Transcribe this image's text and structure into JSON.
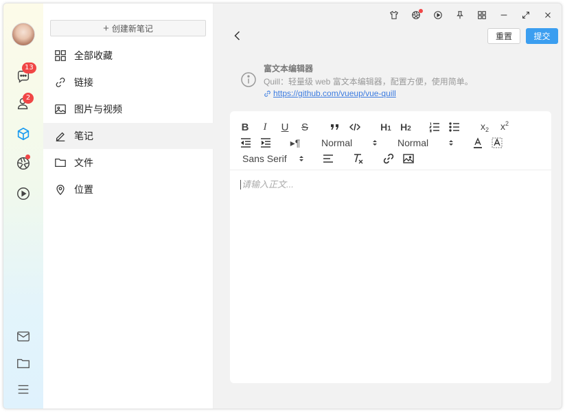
{
  "sidebar": {
    "new_note_label": "创建新笔记",
    "items": [
      {
        "label": "全部收藏",
        "icon": "grid-icon"
      },
      {
        "label": "链接",
        "icon": "link-icon"
      },
      {
        "label": "图片与视频",
        "icon": "image-icon"
      },
      {
        "label": "笔记",
        "icon": "pen-icon",
        "active": true
      },
      {
        "label": "文件",
        "icon": "folder-icon"
      },
      {
        "label": "位置",
        "icon": "location-icon"
      }
    ]
  },
  "rail": {
    "chat_badge": "13",
    "contacts_badge": "2",
    "accent_color": "#1a9bf0"
  },
  "header": {
    "reset_label": "重置",
    "submit_label": "提交"
  },
  "info": {
    "title": "富文本编辑器",
    "description": "Quill：轻量级 web 富文本编辑器，配置方便，使用简单。",
    "link": "https://github.com/vueup/vue-quill"
  },
  "editor": {
    "header_picker_1": "Normal",
    "size_picker": "Normal",
    "font_picker": "Sans Serif",
    "placeholder": "请输入正文..."
  },
  "colors": {
    "primary": "#3b9ef0",
    "badge": "#f04646",
    "link": "#3b7be0"
  }
}
